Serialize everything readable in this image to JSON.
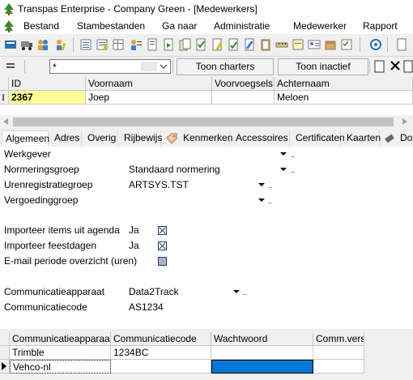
{
  "window": {
    "title": "Transpas Enterprise - Company Green - [Medewerkers]"
  },
  "menu": {
    "items": [
      {
        "label": "Bestand"
      },
      {
        "label": "Stambestanden"
      },
      {
        "label": "Ga naar"
      },
      {
        "label": "Administratie"
      },
      {
        "label": "Medewerker"
      },
      {
        "label": "Rapport"
      }
    ]
  },
  "toolbar": {
    "icons": [
      "record-icon",
      "vehicle-icon",
      "people-icon",
      "person-edit-icon",
      "list-icon",
      "list2-icon",
      "list3-icon",
      "document-icon",
      "document-check-icon",
      "document-edit-icon",
      "check-icon",
      "pencil-icon",
      "ruler-icon",
      "info-icon"
    ]
  },
  "filter": {
    "combo_value": "*",
    "show_charters_label": "Toon charters",
    "show_inactive_label": "Toon inactief"
  },
  "grid": {
    "columns": [
      "ID",
      "Voornaam",
      "Voorvoegsels",
      "Achternaam"
    ],
    "rows": [
      {
        "id": "2367",
        "voornaam": "Joep",
        "voorvoegsels": "",
        "achternaam": "Meloen"
      }
    ]
  },
  "tabs": [
    "Algemeen",
    "Adres",
    "Overig",
    "Rijbewijs",
    "Kenmerken",
    "Accessoires",
    "Certificaten",
    "Kaarten",
    "Do"
  ],
  "form": {
    "werkgever": {
      "label": "Werkgever",
      "value": ""
    },
    "normeringsgroep": {
      "label": "Normeringsgroep",
      "value": "Standaard normering"
    },
    "urenregistratiegroep": {
      "label": "Urenregistratiegroep",
      "value": "ARTSYS.TST"
    },
    "vergoedinggroep": {
      "label": "Vergoedinggroep",
      "value": ""
    },
    "importeer_agenda": {
      "label": "Importeer items uit agenda",
      "value": "Ja",
      "checked": true
    },
    "importeer_feestdagen": {
      "label": "Importeer feestdagen",
      "value": "Ja",
      "checked": true
    },
    "email_periode": {
      "label": "E-mail periode overzicht (uren)",
      "value": "",
      "checked": false
    },
    "communicatieapparaat": {
      "label": "Communicatieapparaat",
      "value": "Data2Track"
    },
    "communicatiecode": {
      "label": "Communicatiecode",
      "value": "AS1234"
    }
  },
  "devices": {
    "columns": [
      "Communicatieapparaat",
      "Communicatiecode",
      "Wachtwoord",
      "Comm.versie"
    ],
    "rows": [
      {
        "apparaat": "Trimble",
        "code": "1234BC",
        "wachtwoord": "",
        "versie": ""
      },
      {
        "apparaat": "Vehco-nl",
        "code": "",
        "wachtwoord": "",
        "versie": ""
      }
    ]
  },
  "colors": {
    "id_highlight": "#ffff99",
    "selection": "#0078d7",
    "accent": "#1d3f7a"
  }
}
